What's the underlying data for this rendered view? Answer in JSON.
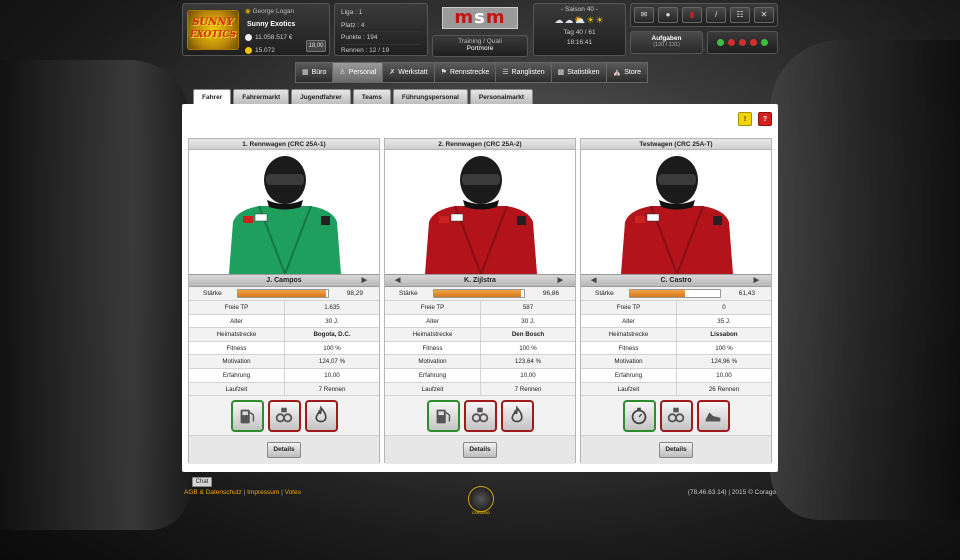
{
  "header": {
    "manager": "George Logan",
    "team": "Sunny Exotics",
    "money": "11.058.517 €",
    "coins": "15.072",
    "version": "18,00",
    "logo_text": [
      "SUNNY",
      "EXOTICS"
    ],
    "league": "Liga : 1",
    "place": "Platz : 4",
    "points": "Punkte : 194",
    "races": "Rennen : 12 / 19",
    "msm_logo": "MSM",
    "training_mode": "Training / Quali",
    "location": "Portmore",
    "season": "- Saison 40 -",
    "day": "Tag 40 / 61",
    "time": "18:16:41",
    "tasks_label": "Aufgaben",
    "tasks_count": "(120 / 131)",
    "toolbar_icons": [
      "mail-icon",
      "user-icon",
      "card-icon",
      "info-icon",
      "network-icon",
      "close-icon"
    ],
    "status_colors": [
      "#3fbf3f",
      "#d03030",
      "#d03030",
      "#d03030",
      "#3fbf3f"
    ]
  },
  "nav": [
    {
      "label": "Büro",
      "icon": "office-icon",
      "active": false
    },
    {
      "label": "Personal",
      "icon": "personnel-icon",
      "active": true
    },
    {
      "label": "Werkstatt",
      "icon": "wrench-icon",
      "active": false
    },
    {
      "label": "Rennstrecke",
      "icon": "flag-icon",
      "active": false
    },
    {
      "label": "Ranglisten",
      "icon": "list-icon",
      "active": false
    },
    {
      "label": "Statistiken",
      "icon": "stats-icon",
      "active": false
    },
    {
      "label": "Store",
      "icon": "store-icon",
      "active": false
    }
  ],
  "tabs": [
    {
      "label": "Fahrer",
      "active": true
    },
    {
      "label": "Fahrermarkt",
      "active": false
    },
    {
      "label": "Jugendfahrer",
      "active": false
    },
    {
      "label": "Teams",
      "active": false
    },
    {
      "label": "Führungspersonal",
      "active": false
    },
    {
      "label": "Personalmarkt",
      "active": false
    }
  ],
  "help": {
    "yellow": "!",
    "red": "?"
  },
  "labels": {
    "strength": "Stärke",
    "free_tp": "Freie TP",
    "age": "Alter",
    "home_track": "Heimatstrecke",
    "fitness": "Fitness",
    "motivation": "Motivation",
    "experience": "Erfahrung",
    "runtime": "Laufzeit",
    "details": "Details"
  },
  "drivers": [
    {
      "car": "1. Rennwagen (CRC 25A-1)",
      "name": "J. Campos",
      "suit_color": "#1e9f5e",
      "strength": "98,29",
      "strength_pct": 98.29,
      "free_tp": "1.635",
      "age": "30 J.",
      "home_track": "Bogota, D.C.",
      "fitness": "100 %",
      "motivation": "124,07 %",
      "experience": "10,00",
      "runtime": "7 Rennen",
      "skills": [
        {
          "icon": "fuel-icon",
          "color": "g"
        },
        {
          "icon": "engine-gears-icon",
          "color": "r"
        },
        {
          "icon": "flame-icon",
          "color": "r"
        }
      ]
    },
    {
      "car": "2. Rennwagen (CRC 25A-2)",
      "name": "K. Zijlstra",
      "suit_color": "#b3141c",
      "strength": "96,86",
      "strength_pct": 96.86,
      "free_tp": "587",
      "age": "30 J.",
      "home_track": "Den Bosch",
      "fitness": "100 %",
      "motivation": "123,64 %",
      "experience": "10,00",
      "runtime": "7 Rennen",
      "skills": [
        {
          "icon": "fuel-icon",
          "color": "g"
        },
        {
          "icon": "engine-gears-icon",
          "color": "r"
        },
        {
          "icon": "flame-icon",
          "color": "r"
        }
      ]
    },
    {
      "car": "Testwagen (CRC 25A-T)",
      "name": "C. Castro",
      "suit_color": "#b3141c",
      "strength": "61,43",
      "strength_pct": 61.43,
      "free_tp": "0",
      "age": "35 J.",
      "home_track": "Lissabon",
      "fitness": "100 %",
      "motivation": "124,96 %",
      "experience": "10,00",
      "runtime": "26 Rennen",
      "skills": [
        {
          "icon": "stopwatch-icon",
          "color": "g"
        },
        {
          "icon": "engine-gears-icon",
          "color": "r"
        },
        {
          "icon": "shoe-icon",
          "color": "r"
        }
      ]
    }
  ],
  "footer": {
    "chat": "Chat",
    "links": [
      "AGB & Datenschutz",
      "Impressum",
      "Votes"
    ],
    "copyright": "(78.46.63.14) | 2015 © Corago",
    "logo_text": "CORAGO"
  }
}
